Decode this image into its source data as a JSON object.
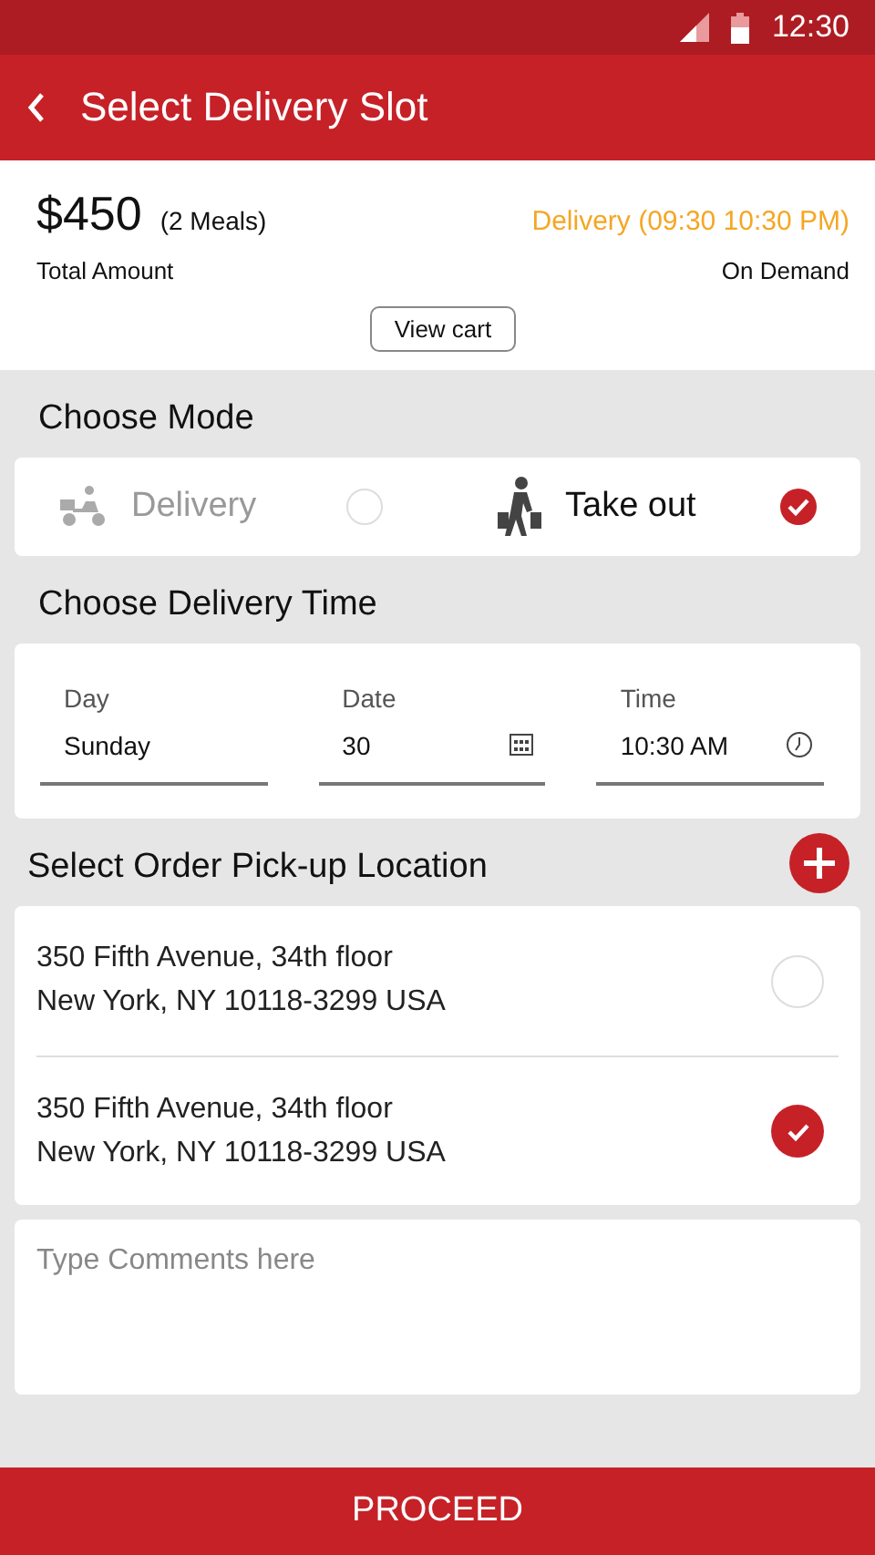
{
  "status_bar": {
    "time": "12:30"
  },
  "app_bar": {
    "title": "Select Delivery Slot"
  },
  "summary": {
    "amount": "$450",
    "meals": "(2 Meals)",
    "amount_label": "Total Amount",
    "delivery_window": "Delivery (09:30 10:30 PM)",
    "delivery_type": "On Demand",
    "view_cart": "View cart"
  },
  "mode": {
    "heading": "Choose Mode",
    "options": [
      {
        "kind": "delivery",
        "label": "Delivery",
        "selected": false
      },
      {
        "kind": "takeout",
        "label": "Take out",
        "selected": true
      }
    ]
  },
  "time": {
    "heading": "Choose Delivery Time",
    "fields": [
      {
        "kind": "day",
        "label": "Day",
        "value": "Sunday"
      },
      {
        "kind": "date",
        "label": "Date",
        "value": "30"
      },
      {
        "kind": "time",
        "label": "Time",
        "value": "10:30 AM"
      }
    ]
  },
  "location": {
    "heading": "Select Order Pick-up Location",
    "addresses": [
      {
        "text": "350 Fifth Avenue, 34th floor\nNew York, NY 10118-3299 USA",
        "selected": false
      },
      {
        "text": "350 Fifth Avenue, 34th floor\nNew York, NY 10118-3299 USA",
        "selected": true
      }
    ]
  },
  "comments": {
    "placeholder": "Type Comments here"
  },
  "proceed": "PROCEED"
}
